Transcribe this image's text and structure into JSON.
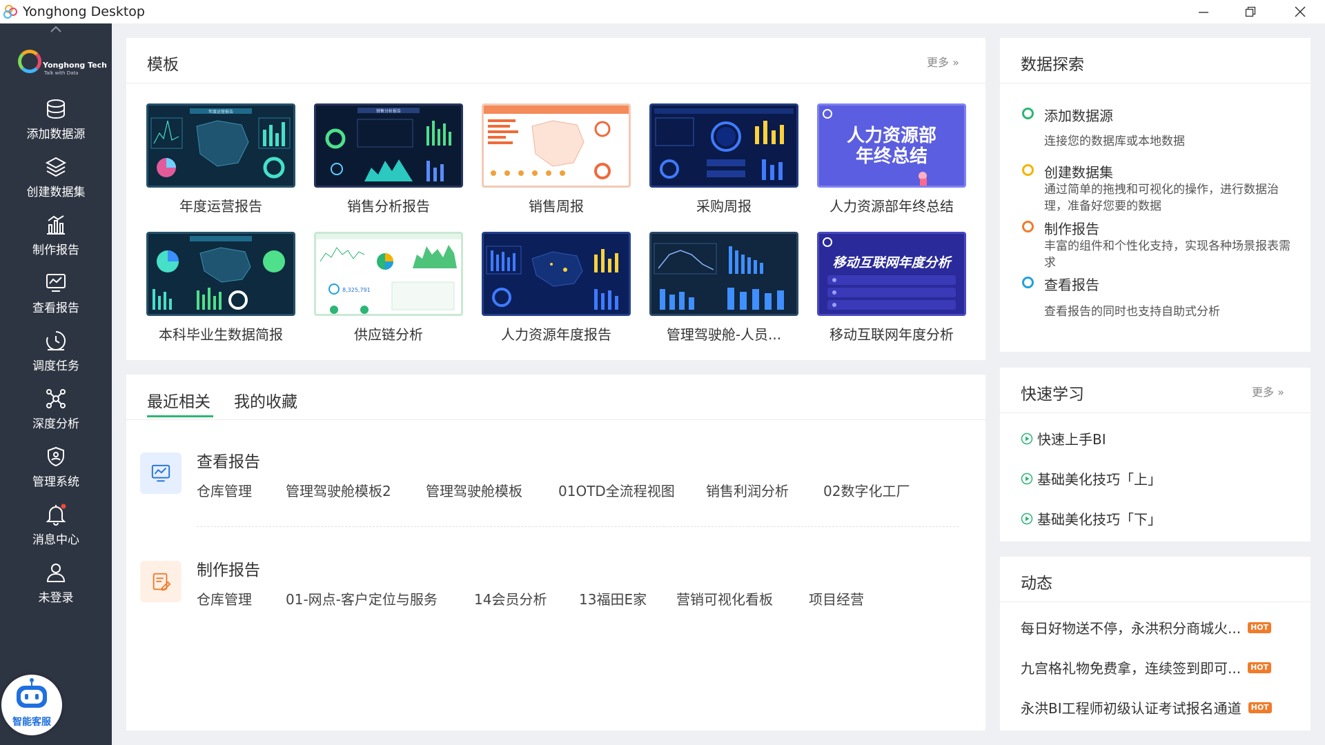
{
  "window": {
    "title": "Yonghong Desktop"
  },
  "brand": {
    "name": "Yonghong Tech",
    "tagline": "Talk with Data"
  },
  "sidebar": {
    "items": [
      {
        "label": "添加数据源",
        "icon": "database-icon"
      },
      {
        "label": "创建数据集",
        "icon": "layers-icon"
      },
      {
        "label": "制作报告",
        "icon": "bar-chart-icon"
      },
      {
        "label": "查看报告",
        "icon": "monitor-chart-icon"
      },
      {
        "label": "调度任务",
        "icon": "clock-icon"
      },
      {
        "label": "深度分析",
        "icon": "network-icon"
      },
      {
        "label": "管理系统",
        "icon": "shield-icon"
      },
      {
        "label": "消息中心",
        "icon": "bell-icon"
      },
      {
        "label": "未登录",
        "icon": "user-icon"
      }
    ],
    "assistant_label": "智能客服"
  },
  "templates": {
    "title": "模板",
    "more": "更多",
    "items": [
      {
        "label": "年度运营报告"
      },
      {
        "label": "销售分析报告"
      },
      {
        "label": "销售周报"
      },
      {
        "label": "采购周报"
      },
      {
        "label": "人力资源部年终总结"
      },
      {
        "label": "本科毕业生数据简报"
      },
      {
        "label": "供应链分析"
      },
      {
        "label": "人力资源年度报告"
      },
      {
        "label": "管理驾驶舱-人员..."
      },
      {
        "label": "移动互联网年度分析"
      }
    ],
    "thumb_texts": {
      "t1": "年度运营报告",
      "t2": "销售分析报告",
      "t5_line1": "人力资源部",
      "t5_line2": "年终总结",
      "t7_value": "8,325,791",
      "t10": "移动互联网年度分析"
    }
  },
  "recent": {
    "tabs": [
      "最近相关",
      "我的收藏"
    ],
    "sections": [
      {
        "title": "查看报告",
        "items": [
          "仓库管理",
          "管理驾驶舱模板2",
          "管理驾驶舱模板",
          "01OTD全流程视图",
          "销售利润分析",
          "02数字化工厂"
        ]
      },
      {
        "title": "制作报告",
        "items": [
          "仓库管理",
          "01-网点-客户定位与服务",
          "14会员分析",
          "13福田E家",
          "营销可视化看板",
          "项目经营"
        ]
      }
    ]
  },
  "explore": {
    "title": "数据探索",
    "steps": [
      {
        "title": "添加数据源",
        "desc": "连接您的数据库或本地数据",
        "color": "#2bb673"
      },
      {
        "title": "创建数据集",
        "desc": "通过简单的拖拽和可视化的操作，进行数据治理，准备好您要的数据",
        "color": "#f5b300"
      },
      {
        "title": "制作报告",
        "desc": "丰富的组件和个性化支持，实现各种场景报表需求",
        "color": "#f07b2a"
      },
      {
        "title": "查看报告",
        "desc": "查看报告的同时也支持自助式分析",
        "color": "#1fa0e0"
      }
    ]
  },
  "learn": {
    "title": "快速学习",
    "more": "更多",
    "items": [
      "快速上手BI",
      "基础美化技巧「上」",
      "基础美化技巧「下」"
    ]
  },
  "news": {
    "title": "动态",
    "hot_label": "HOT",
    "items": [
      "每日好物送不停，永洪积分商城火...",
      "九宫格礼物免费拿，连续签到即可...",
      "永洪BI工程师初级认证考试报名通道"
    ]
  }
}
